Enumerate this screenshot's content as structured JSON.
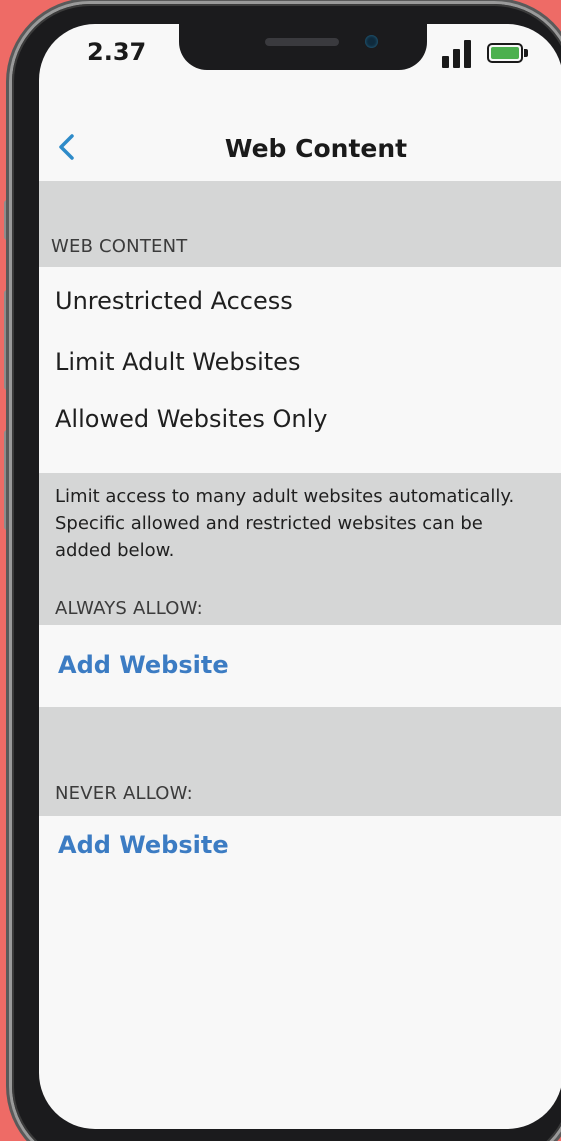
{
  "status_bar": {
    "time": "2.37",
    "signal_icon": "signal-icon",
    "battery_icon": "battery-icon",
    "battery_color": "#4cb04e"
  },
  "nav": {
    "back_icon": "chevron-left-icon",
    "title": "Web Content",
    "accent_color": "#2e8bc9"
  },
  "web_content": {
    "header": "WEB CONTENT",
    "options": [
      {
        "label": "Unrestricted Access"
      },
      {
        "label": "Limit Adult Websites"
      },
      {
        "label": "Allowed Websites Only"
      }
    ],
    "footer": "Limit access to many adult websites automatically. Specific allowed and restricted websites can be added below."
  },
  "always_allow": {
    "header": "ALWAYS ALLOW:",
    "add_label": "Add Website"
  },
  "never_allow": {
    "header": "NEVER ALLOW:",
    "add_label": "Add Website"
  },
  "colors": {
    "background": "#ee6b66",
    "link": "#3c7cc3",
    "section_band": "#d5d6d6"
  }
}
